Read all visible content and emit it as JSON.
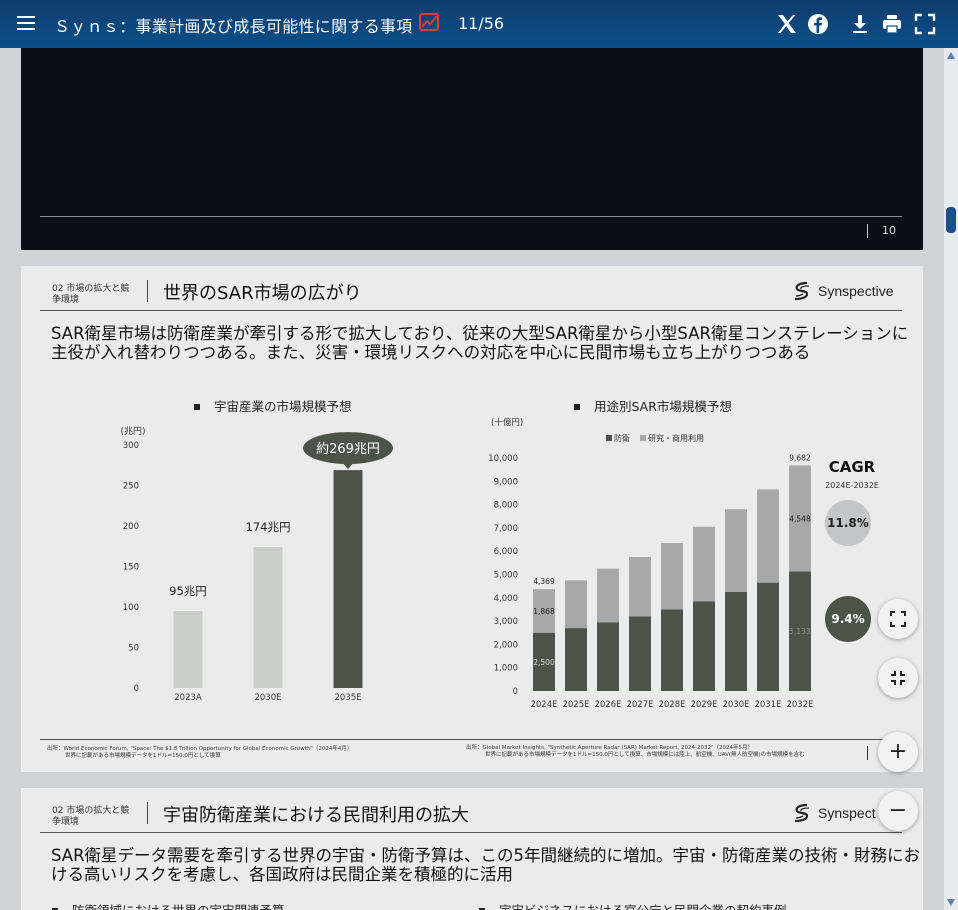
{
  "toolbar": {
    "title": "Ｓｙｎｓ：事業計画及び成長可能性に関する事項",
    "page_counter": "11/56",
    "icons": [
      "menu-icon",
      "chart-trend-icon",
      "x-logo-icon",
      "facebook-icon",
      "download-icon",
      "print-icon",
      "fullscreen-icon"
    ]
  },
  "prev_slide": {
    "page_number": "10"
  },
  "slide": {
    "section_label": "02 市場の拡大と競争環境",
    "title": "世界のSAR市場の広がり",
    "brand": "Synspective",
    "lead": "SAR衛星市場は防衛産業が牽引する形で拡大しており、従来の大型SAR衛星から小型SAR衛星コンステレーションに主役が入れ替わりつつある。また、災害・環境リスクへの対応を中心に民間市場も立ち上がりつつある",
    "footnote_left_1": "出所：World Economic Forum, \"Space: The $1.8 Trillion Opportunity for Global Economic Growth\"（2024年4月）",
    "footnote_left_2": "世界に記載がある市場規模データを1ドル=150.0円として換算",
    "footnote_right_1": "出所：Global Market Insights, \"Synthetic Aperture Radar (SAR) Market Report, 2024-2032\"（2024年5月）",
    "footnote_right_2": "世界に記載がある市場規模データを1ドル=150.0円として換算、市場規模には陸上、航空機、UAV(無人航空機)の市場規模を含む"
  },
  "next_slide": {
    "section_label": "02 市場の拡大と競争環境",
    "title": "宇宙防衛産業における民間利用の拡大",
    "brand": "Synspect",
    "lead": "SAR衛星データ需要を牽引する世界の宇宙・防衛予算は、この5年間継続的に増加。宇宙・防衛産業の技術・財務における高いリスクを考慮し、各国政府は民間企業を積極的に活用",
    "sub_left": "防衛領域における世界の宇宙関連予算",
    "sub_right": "宇宙ビジネスにおける官公庁と民間企業の契約事例"
  },
  "zoom_controls": [
    "fullscreen-enter-icon",
    "fullscreen-exit-icon",
    "zoom-in-icon",
    "zoom-out-icon"
  ],
  "colors": {
    "dark_bar": "#4a5548",
    "light_bar": "#c9cfc8",
    "gray_bar": "#a6a8a9",
    "accent": "#e0393e",
    "toolbar": "#0e4577"
  },
  "chart_data": [
    {
      "type": "bar",
      "title": "宇宙産業の市場規模予想",
      "ylabel": "(兆円)",
      "categories": [
        "2023A",
        "2030E",
        "2035E"
      ],
      "values": [
        95,
        174,
        269
      ],
      "data_labels": [
        "95兆円",
        "174兆円",
        "約269兆円"
      ],
      "ylim": [
        0,
        300
      ],
      "yticks": [
        0,
        50,
        100,
        150,
        200,
        250,
        300
      ],
      "grid": false
    },
    {
      "type": "bar",
      "stacked": true,
      "title": "用途別SAR市場規模予想",
      "ylabel": "(十億円)",
      "categories": [
        "2024E",
        "2025E",
        "2026E",
        "2027E",
        "2028E",
        "2029E",
        "2030E",
        "2031E",
        "2032E"
      ],
      "series": [
        {
          "name": "防衛",
          "values": [
            2500,
            2700,
            2950,
            3200,
            3500,
            3850,
            4250,
            4650,
            5133
          ]
        },
        {
          "name": "研究・商用利用",
          "values": [
            1868,
            2050,
            2300,
            2550,
            2850,
            3200,
            3550,
            4000,
            4548
          ]
        }
      ],
      "totals": [
        4369,
        null,
        null,
        null,
        null,
        null,
        null,
        null,
        9682
      ],
      "ylim": [
        0,
        10000
      ],
      "yticks": [
        0,
        1000,
        2000,
        3000,
        4000,
        5000,
        6000,
        7000,
        8000,
        9000,
        10000
      ],
      "ytick_labels": [
        "0",
        "1,000",
        "2,000",
        "3,000",
        "4,000",
        "5,000",
        "6,000",
        "7,000",
        "8,000",
        "9,000",
        "10,000"
      ],
      "data_labels": {
        "first_total": "4,369",
        "first_top": "1,868",
        "first_bottom": "2,500",
        "last_total": "9,682",
        "last_top": "4,548",
        "last_bottom": "5,133"
      },
      "legend": "top-left",
      "cagr": {
        "title": "CAGR",
        "period": "2024E-2032E",
        "research": "11.8%",
        "defense": "9.4%"
      }
    }
  ]
}
